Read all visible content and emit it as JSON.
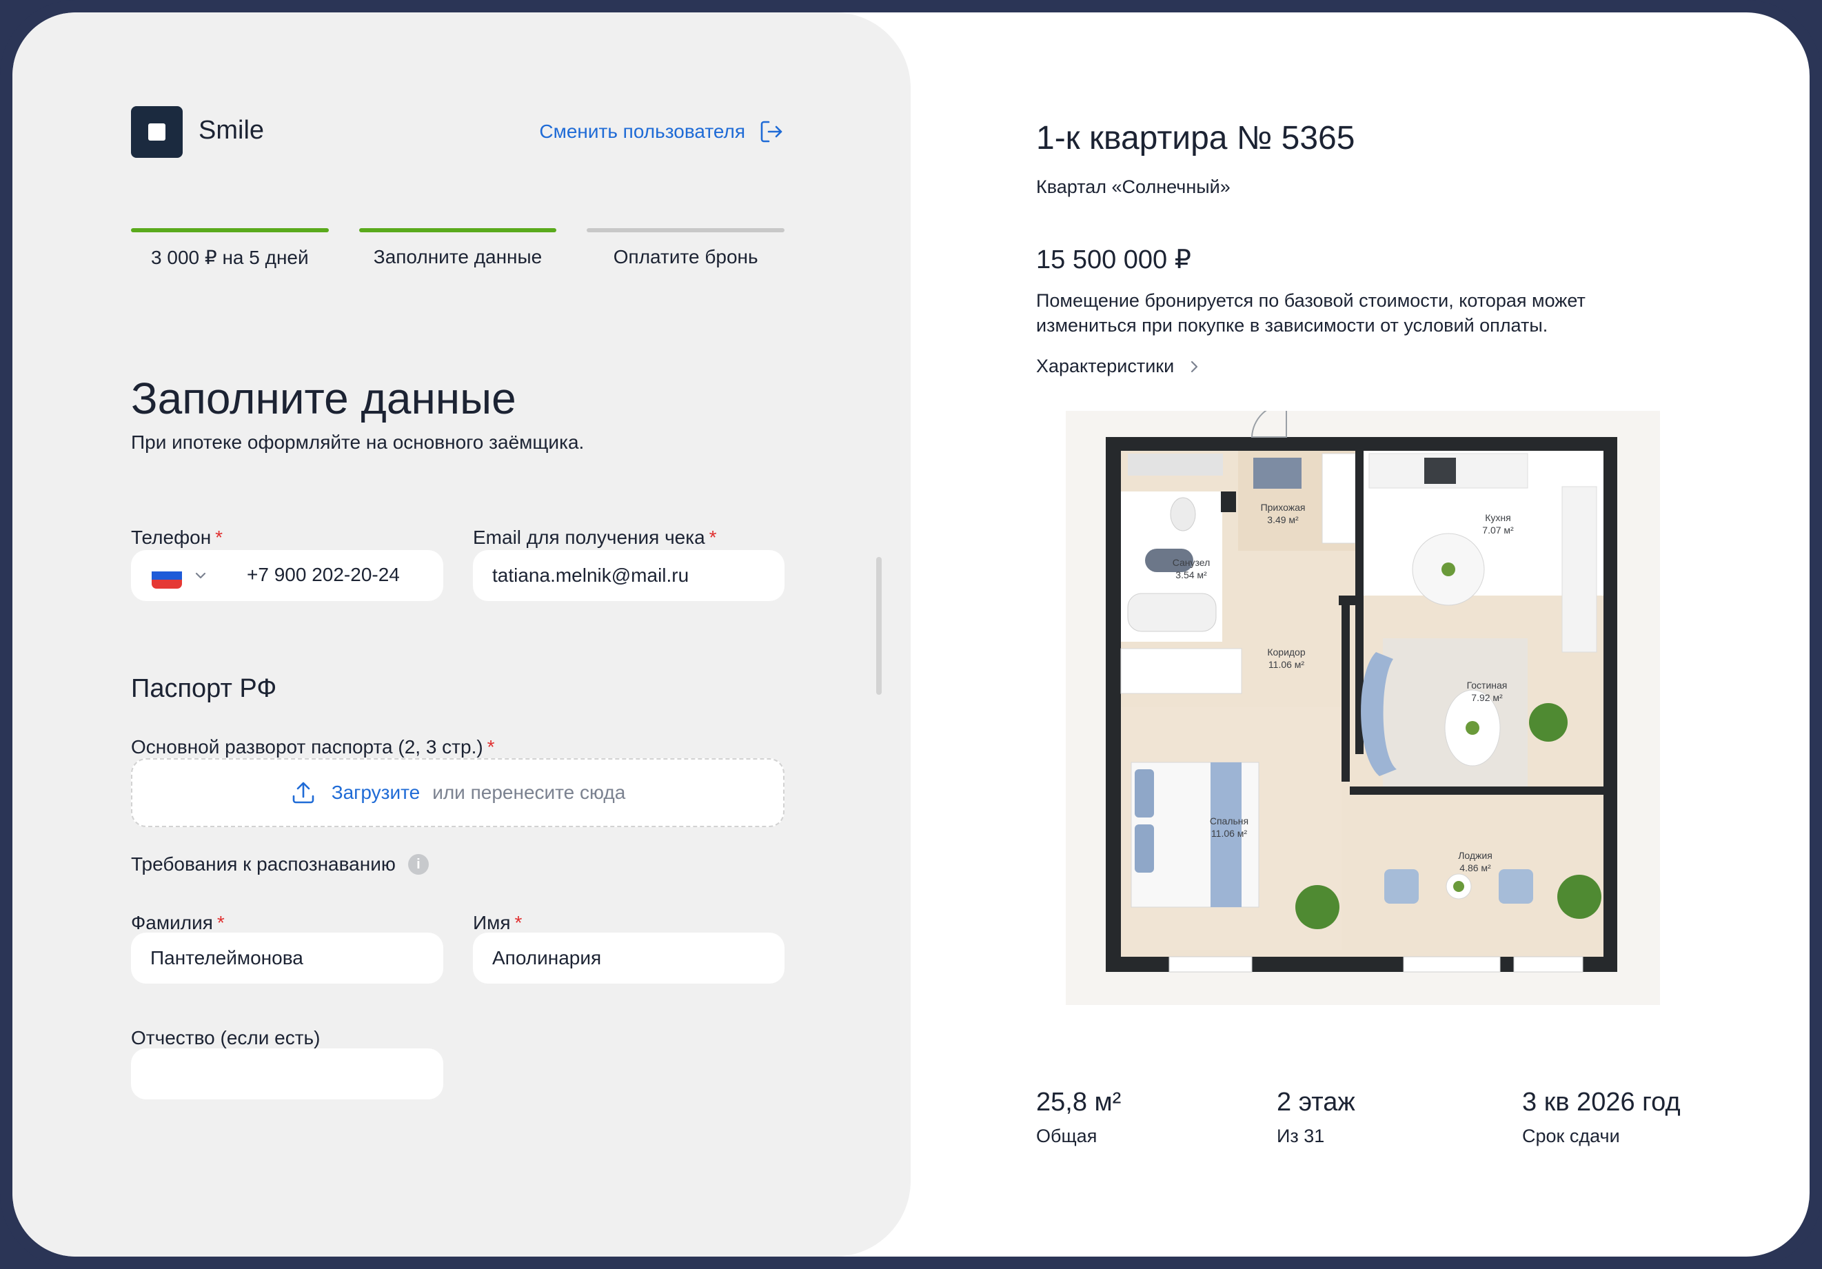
{
  "brand": {
    "name": "Smile"
  },
  "header": {
    "switch_user_label": "Сменить пользователя"
  },
  "steps": [
    {
      "label": "3 000 ₽ на 5 дней",
      "done": true
    },
    {
      "label": "Заполните данные",
      "done": true
    },
    {
      "label": "Оплатите бронь",
      "done": false
    }
  ],
  "form": {
    "title": "Заполните данные",
    "subtitle": "При ипотеке оформляйте на основного заёмщика.",
    "phone": {
      "label": "Телефон",
      "required": "*",
      "value": "+7 900 202-20-24",
      "country": "RU"
    },
    "email": {
      "label": "Email для получения чека",
      "required": "*",
      "value": "tatiana.melnik@mail.ru"
    },
    "passport_section": "Паспорт РФ",
    "passport_upload": {
      "label": "Основной разворот паспорта (2, 3 стр.)",
      "required": "*",
      "link": "Загрузите",
      "hint": "или перенесите сюда"
    },
    "recognition_requirements": "Требования к распознаванию",
    "last_name": {
      "label": "Фамилия",
      "required": "*",
      "value": "Пантелеймонова"
    },
    "first_name": {
      "label": "Имя",
      "required": "*",
      "value": "Аполинария"
    },
    "middle_name": {
      "label": "Отчество (если есть)",
      "value": ""
    }
  },
  "apartment": {
    "title": "1-к квартира № 5365",
    "complex": "Квартал «Солнечный»",
    "price": "15 500 000 ₽",
    "note": "Помещение бронируется по базовой стоимости, которая может измениться при покупке в зависимости от условий оплаты.",
    "characteristics_link": "Характеристики",
    "rooms": [
      {
        "name": "Прихожая",
        "area": "3.49 м²"
      },
      {
        "name": "Кухня",
        "area": "7.07 м²"
      },
      {
        "name": "Санузел",
        "area": "3.54 м²"
      },
      {
        "name": "Коридор",
        "area": "11.06 м²"
      },
      {
        "name": "Гостиная",
        "area": "7.92 м²"
      },
      {
        "name": "Спальня",
        "area": "11.06 м²"
      },
      {
        "name": "Лоджия",
        "area": "4.86 м²"
      }
    ],
    "stats": [
      {
        "value": "25,8 м²",
        "label": "Общая"
      },
      {
        "value": "2 этаж",
        "label": "Из 31"
      },
      {
        "value": "3 кв 2026 год",
        "label": "Срок сдачи"
      }
    ]
  },
  "colors": {
    "frame": "#2b3556",
    "left_panel": "#f0f0f0",
    "accent_link": "#1f6bd6",
    "step_done": "#5aaa1c",
    "step_pending": "#c8c8c8",
    "required": "#e03131"
  },
  "icons": {
    "logo": "logo-square-icon",
    "switch_user": "logout-arrow-icon",
    "flag": "russia-flag-icon",
    "chevron": "chevron-down-icon",
    "upload": "upload-icon",
    "info": "info-icon",
    "chars": "chevron-right-icon"
  }
}
